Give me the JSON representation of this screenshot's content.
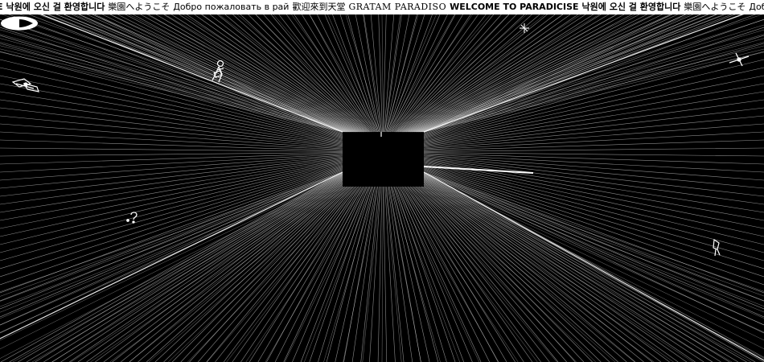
{
  "marquee": {
    "items": [
      {
        "text": "E",
        "style": "bold"
      },
      {
        "text": "낙원에 오신 걸 환영합니다",
        "style": "bold"
      },
      {
        "text": "樂園へようこそ",
        "style": "plain"
      },
      {
        "text": "Добро пожаловать в рай",
        "style": "plain"
      },
      {
        "text": "歡迎來到天堂",
        "style": "plain"
      },
      {
        "text": "GRATAM PARADISO",
        "style": "serif"
      },
      {
        "text": "WELCOME TO PARADICISE",
        "style": "bold"
      },
      {
        "text": "낙원에 오신 걸 환영합니다",
        "style": "bold"
      },
      {
        "text": "樂園へようこそ",
        "style": "plain"
      },
      {
        "text": "Добро пожаловать",
        "style": "plain"
      }
    ]
  },
  "scene": {
    "background_color": "#000000",
    "line_color": "#ffffff",
    "logo_icon": "eye-icon",
    "floating_icons": [
      "satellite-icon",
      "astronaut-icon",
      "question-mark-icon",
      "star-sparkle-icon",
      "small-star-icon",
      "figure-icon",
      "light-beam-icon"
    ]
  }
}
